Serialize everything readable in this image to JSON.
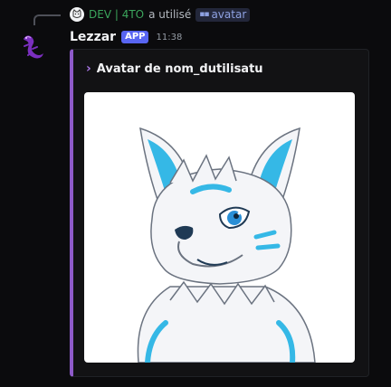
{
  "reply": {
    "user": "DEV | 4TO",
    "action": "a utilisé",
    "command": "avatar"
  },
  "message": {
    "username": "Lezzar",
    "badge": "APP",
    "time": "11:38"
  },
  "embed": {
    "title": "Avatar de nom_dutilisatu",
    "accent_color": "#8e5ac9",
    "image_alt": "furry wolf avatar"
  },
  "icons": {
    "reply_avatar": "cat-face-icon",
    "user_avatar": "purple-lizard-icon",
    "command": "slash-command-icon",
    "title": "chevron-right-icon"
  }
}
